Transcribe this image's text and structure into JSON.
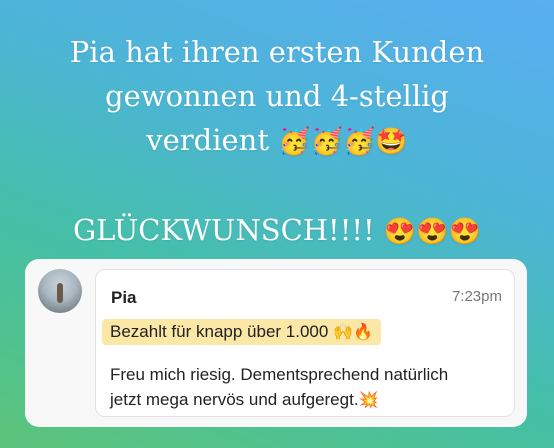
{
  "caption": {
    "line1": "Pia hat ihren ersten Kunden",
    "line2": "gewonnen und 4-stellig",
    "line3_text": "verdient ",
    "line3_emoji": "🥳🥳🥳🤩",
    "line4_text": "GLÜCKWUNSCH!!!! ",
    "line4_emoji": "😍😍😍"
  },
  "message": {
    "author": "Pia",
    "time": "7:23pm",
    "highlight_text": "Bezahlt für knapp über 1.000",
    "highlight_emoji": "🙌🔥",
    "highlight_color": "#fbe8a6",
    "body_line1": "Freu mich riesig. Dementsprechend natürlich",
    "body_line2_text": "jetzt mega nervös und aufgeregt.",
    "body_line2_emoji": "💥"
  }
}
